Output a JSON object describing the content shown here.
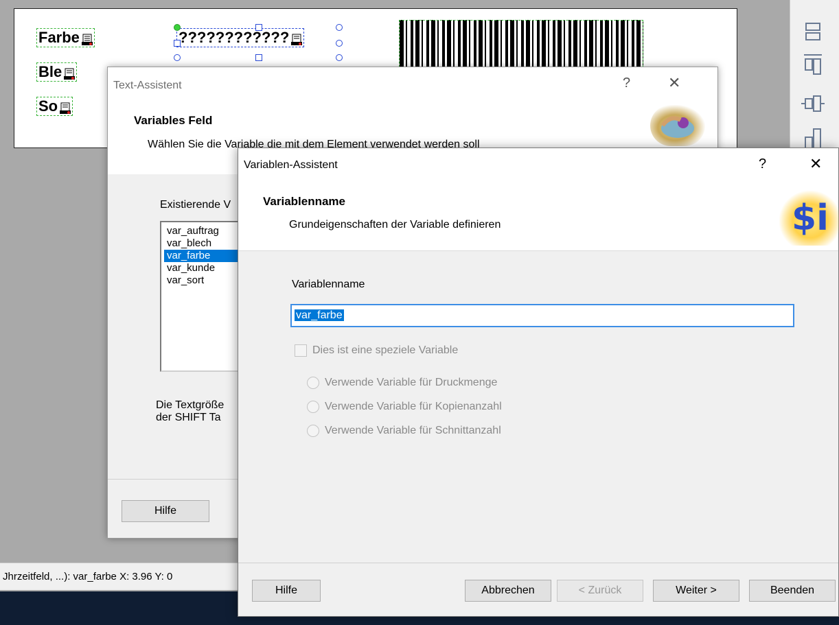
{
  "canvas": {
    "fields": [
      "Farbe",
      "Ble",
      "So"
    ],
    "placeholder_field": "????????????"
  },
  "status_bar": {
    "text": "Jhrzeitfeld, ...): var_farbe  X:  3.96 Y:  0"
  },
  "text_assistant": {
    "title": "Text-Assistent",
    "help_ctrl": "?",
    "close_ctrl": "✕",
    "heading": "Variables Feld",
    "subheading": "Wählen Sie die Variable die mit dem Element verwendet werden soll",
    "existing_label": "Existierende V",
    "variables": [
      "var_auftrag",
      "var_blech",
      "var_farbe",
      "var_kunde",
      "var_sort"
    ],
    "selected_index": 2,
    "hint_line1": "Die Textgröße",
    "hint_line2": "der SHIFT Ta",
    "help_button": "Hilfe"
  },
  "variable_assistant": {
    "title": "Variablen-Assistent",
    "help_ctrl": "?",
    "close_ctrl": "✕",
    "heading": "Variablenname",
    "subheading": "Grundeigenschaften der Variable definieren",
    "logo_text": "$i",
    "name_label": "Variablenname",
    "name_value": "var_farbe",
    "special_checkbox": "Dies ist eine speziele Variable",
    "radio_options": [
      "Verwende Variable für Druckmenge",
      "Verwende Variable für Kopienanzahl",
      "Verwende Variable für Schnittanzahl"
    ],
    "buttons": {
      "help": "Hilfe",
      "cancel": "Abbrechen",
      "back": "< Zurück",
      "next": "Weiter >",
      "finish": "Beenden"
    }
  },
  "colors": {
    "selection": "#0078d7",
    "focus_border": "#3d8ee6",
    "field_dash": "#3bb53b",
    "taskbar": "#0f1d33"
  }
}
